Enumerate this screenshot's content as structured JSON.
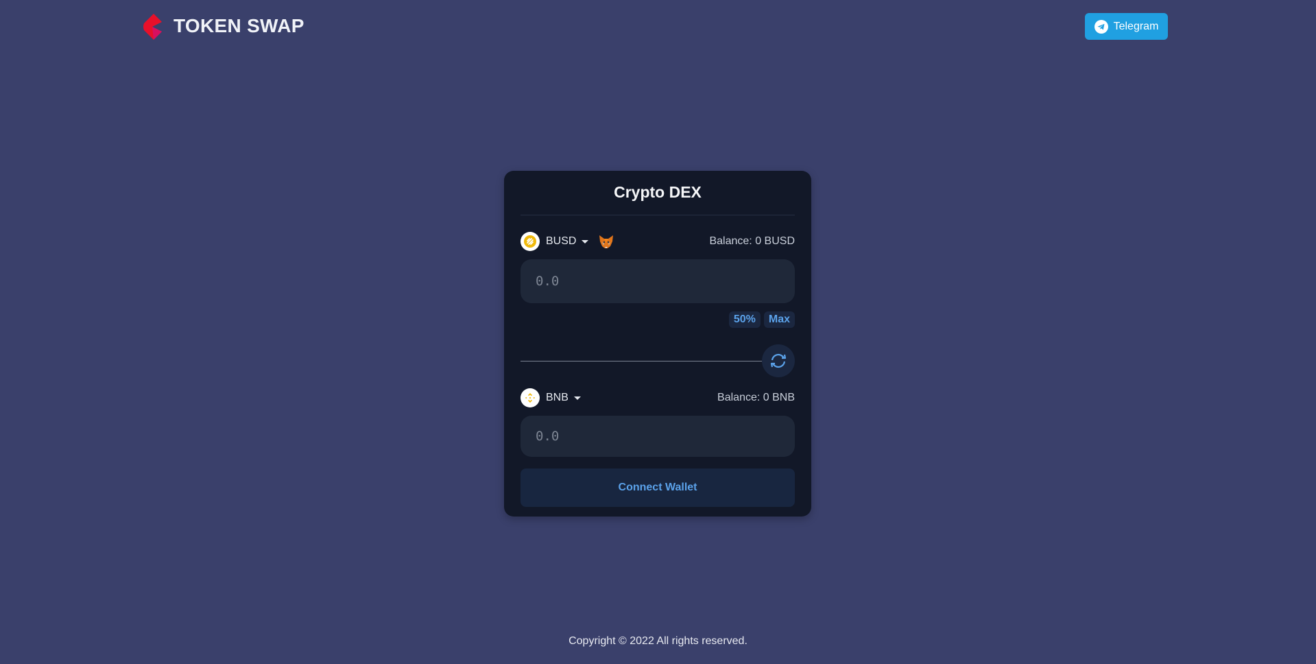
{
  "header": {
    "brand": "TOKEN SWAP",
    "telegram_label": "Telegram"
  },
  "card": {
    "title": "Crypto DEX",
    "from": {
      "token": "BUSD",
      "token_icon": "busd-icon",
      "balance": "Balance: 0 BUSD",
      "placeholder": "0.0",
      "value": ""
    },
    "quick_amounts": [
      "50%",
      "Max"
    ],
    "swap_icon": "swap-arrows-icon",
    "to": {
      "token": "BNB",
      "token_icon": "bnb-icon",
      "balance": "Balance: 0 BNB",
      "placeholder": "0.0",
      "value": ""
    },
    "connect_label": "Connect Wallet"
  },
  "footer": {
    "copyright": "Copyright © 2022 All rights reserved."
  },
  "colors": {
    "background": "#3a406b",
    "card": "#121828",
    "input": "#1f2839",
    "accent": "#5ba2ea",
    "telegram": "#20a0e1",
    "logo": "#e8102a"
  }
}
